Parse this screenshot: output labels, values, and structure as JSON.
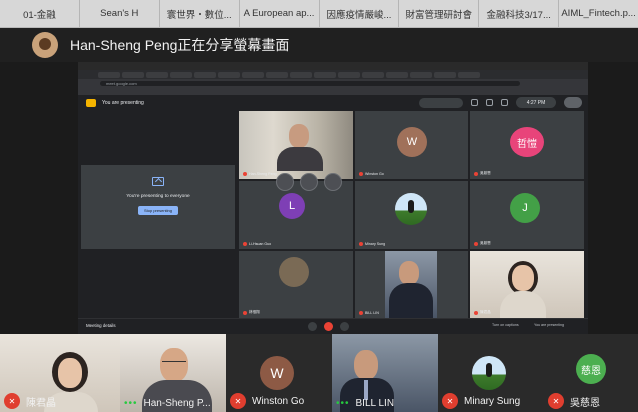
{
  "browser_tabs": [
    "01-金融",
    "Sean's H",
    "寰世界・數位...",
    "A European ap...",
    "因應疫情嚴峻...",
    "財富管理研討會",
    "金融科技3/17...",
    "AIML_Fintech.p..."
  ],
  "banner": {
    "text": "Han-Sheng Peng正在分享螢幕畫面"
  },
  "shared": {
    "address": "meet.google.com",
    "presenting_label": "You are presenting",
    "clock": "4:27 PM",
    "present_box_text": "You're presenting to everyone",
    "stop_label": "Stop presenting",
    "tiles": [
      {
        "name": "Han-Sheng Peng"
      },
      {
        "name": "Winston Go",
        "initial": "W",
        "color": "#a0715a"
      },
      {
        "name": "吳慈恩",
        "initial": "哲愷",
        "color": "#e8447a"
      },
      {
        "name": "Li-Hsuan Guo",
        "initial": "L",
        "color": "#7e3fb5"
      },
      {
        "name": "Minary Sung"
      },
      {
        "name": "吳慈恩",
        "initial": "J",
        "color": "#43a047"
      },
      {
        "name": "林惟翔"
      },
      {
        "name": "BILL LIN"
      },
      {
        "name": "陳君晶"
      }
    ],
    "meeting_details": "Meeting details",
    "captions_label": "Turn on captions",
    "present_label": "You are presenting"
  },
  "participants": [
    {
      "name": "陳君晶",
      "muted": true
    },
    {
      "name": "Han-Sheng P...",
      "muted": false
    },
    {
      "name": "Winston Go",
      "muted": true,
      "initial": "W",
      "color": "#8d5a45"
    },
    {
      "name": "BILL LIN",
      "muted": false
    },
    {
      "name": "Minary Sung",
      "muted": true
    },
    {
      "name": "吳慈恩",
      "muted": true,
      "initial": "慈恩",
      "color": "#4caf50"
    }
  ]
}
